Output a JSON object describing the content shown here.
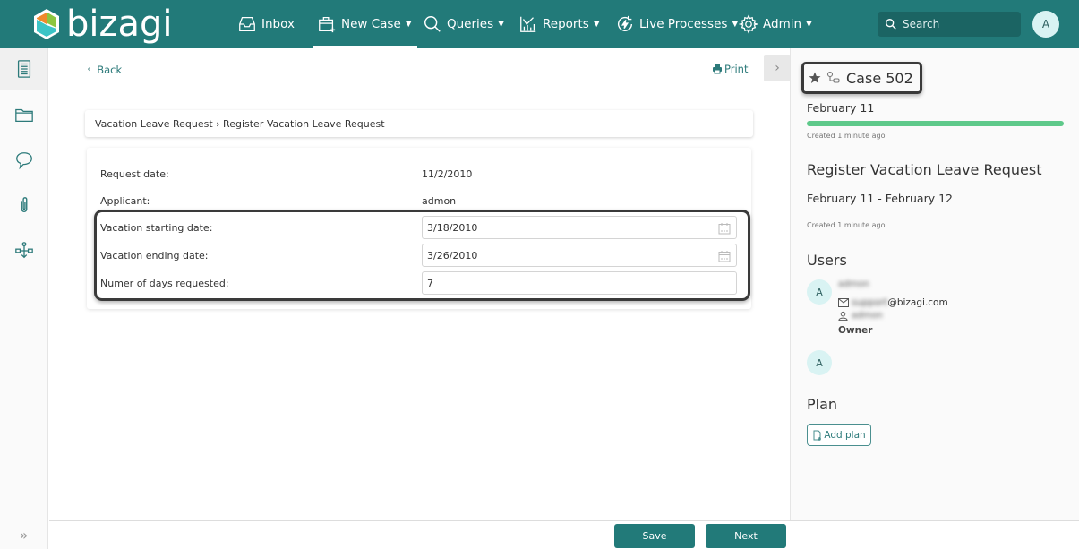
{
  "app": {
    "logo_text": "bizagi",
    "colors": {
      "primary": "#227a79",
      "progress": "#5ec98a",
      "avatar_bg": "#d9f3f3"
    }
  },
  "topnav": {
    "items": [
      {
        "label": "Inbox",
        "icon": "inbox-icon",
        "has_dropdown": false
      },
      {
        "label": "New Case",
        "icon": "new-case-icon",
        "has_dropdown": true,
        "active": true
      },
      {
        "label": "Queries",
        "icon": "search-icon",
        "has_dropdown": true
      },
      {
        "label": "Reports",
        "icon": "reports-icon",
        "has_dropdown": true
      },
      {
        "label": "Live Processes",
        "icon": "live-processes-icon",
        "has_dropdown": true
      },
      {
        "label": "Admin",
        "icon": "gear-icon",
        "has_dropdown": true
      }
    ],
    "caret": "▼",
    "search_placeholder": "Search",
    "user_initial": "A"
  },
  "sidebar": {
    "items": [
      {
        "name": "form",
        "icon": "form-icon",
        "active": true
      },
      {
        "name": "folders",
        "icon": "folder-icon"
      },
      {
        "name": "comments",
        "icon": "comment-icon"
      },
      {
        "name": "attachments",
        "icon": "paperclip-icon"
      },
      {
        "name": "process-map",
        "icon": "workflow-icon"
      }
    ],
    "expand_glyph": "»"
  },
  "main": {
    "back_label": "Back",
    "back_glyph": "‹",
    "print_label": "Print",
    "collapse_glyph": "›",
    "breadcrumb": "Vacation Leave Request › Register Vacation Leave Request",
    "form": {
      "request_date": {
        "label": "Request date:",
        "value": "11/2/2010"
      },
      "applicant": {
        "label": "Applicant:",
        "value": "admon"
      },
      "start_date": {
        "label": "Vacation starting date:",
        "value": "3/18/2010"
      },
      "end_date": {
        "label": "Vacation ending date:",
        "value": "3/26/2010"
      },
      "days": {
        "label": "Numer of days requested:",
        "value": "7"
      }
    }
  },
  "footer": {
    "save_label": "Save",
    "next_label": "Next"
  },
  "case_panel": {
    "case_title": "Case 502",
    "case_date": "February 11",
    "case_progress_percent": 100,
    "case_created": "Created 1 minute ago",
    "task_title": "Register Vacation Leave Request",
    "task_dates": "February 11 - February 12",
    "task_created": "Created 1 minute ago",
    "users_heading": "Users",
    "users": [
      {
        "initial": "A",
        "name": "admon",
        "email_local": "support",
        "email_domain": "@bizagi.com",
        "username": "admon",
        "role": "Owner"
      },
      {
        "initial": "A"
      }
    ],
    "plan_heading": "Plan",
    "add_plan_label": "Add plan"
  }
}
